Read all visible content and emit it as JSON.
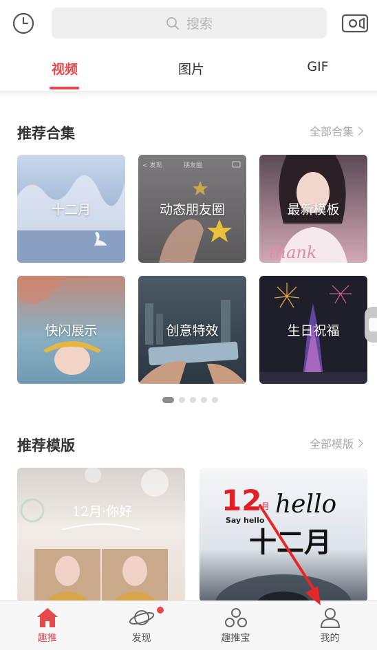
{
  "search": {
    "placeholder": "搜索"
  },
  "tabs": [
    {
      "label": "视频",
      "active": true
    },
    {
      "label": "图片",
      "active": false
    },
    {
      "label": "GIF",
      "active": false
    }
  ],
  "collections": {
    "title": "推荐合集",
    "more": "全部合集",
    "cards": [
      {
        "label": "十二月"
      },
      {
        "label": "动态朋友圈",
        "overlay_left": "< 发现",
        "overlay_center": "朋友圈"
      },
      {
        "label": "最新模板",
        "overlay_text": "thank"
      },
      {
        "label": "快闪展示"
      },
      {
        "label": "创意特效"
      },
      {
        "label": "生日祝福"
      }
    ],
    "carousel": {
      "count": 5,
      "active_index": 0
    }
  },
  "templates": {
    "title": "推荐模版",
    "more": "全部模版",
    "items": [
      {
        "overlay_text": "12月·你好"
      },
      {
        "number": "12",
        "small_text": "月",
        "hello": "hello",
        "say_hello": "Say hello",
        "big_text": "十二月"
      }
    ]
  },
  "bottom_nav": [
    {
      "label": "趣推",
      "icon": "home-icon",
      "active": true
    },
    {
      "label": "发现",
      "icon": "planet-icon",
      "active": false,
      "badge": true
    },
    {
      "label": "趣推宝",
      "icon": "molecule-icon",
      "active": false
    },
    {
      "label": "我的",
      "icon": "person-icon",
      "active": false
    }
  ],
  "colors": {
    "accent": "#e5484d",
    "annotation_arrow": "#e8262a"
  }
}
